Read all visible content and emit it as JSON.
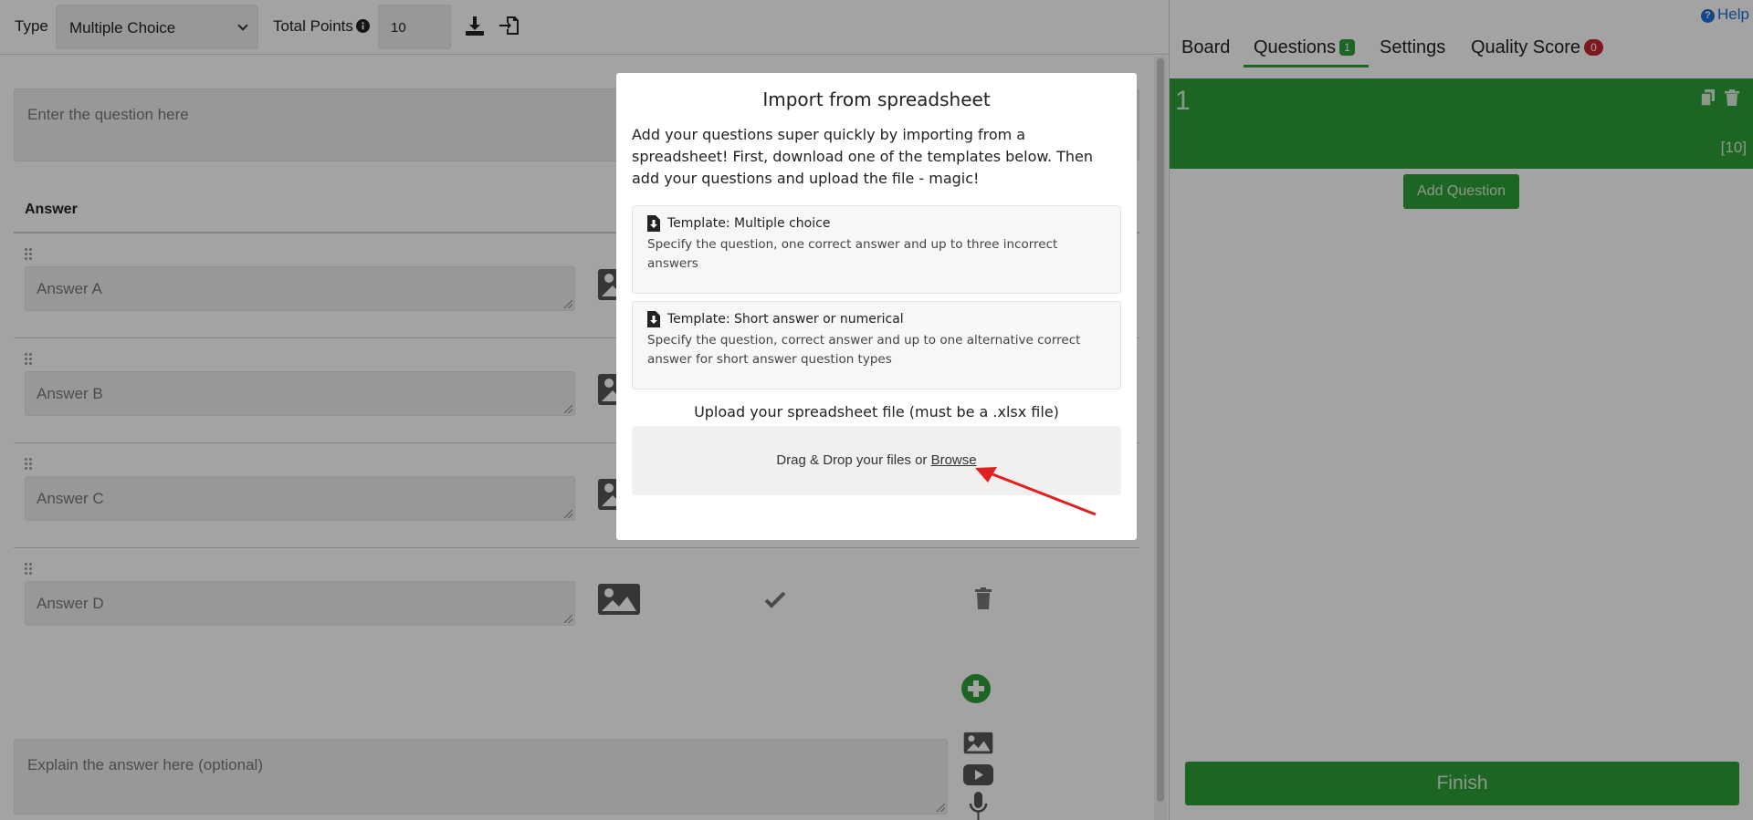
{
  "toolbar": {
    "type_label": "Type",
    "type_value": "Multiple Choice",
    "total_points_label": "Total Points",
    "total_points_value": "10"
  },
  "editor": {
    "question_placeholder": "Enter the question here",
    "answer_header": "Answer",
    "answers": [
      {
        "placeholder": "Answer A"
      },
      {
        "placeholder": "Answer B"
      },
      {
        "placeholder": "Answer C"
      },
      {
        "placeholder": "Answer D"
      }
    ],
    "explanation_placeholder": "Explain the answer here (optional)"
  },
  "sidebar": {
    "help_label": "Help",
    "tabs": [
      {
        "label": "Board",
        "badge": ""
      },
      {
        "label": "Questions",
        "badge": "1"
      },
      {
        "label": "Settings",
        "badge": ""
      },
      {
        "label": "Quality Score",
        "badge": "0"
      }
    ],
    "question_card": {
      "number": "1",
      "points": "[10]"
    },
    "add_question_label": "Add Question",
    "finish_label": "Finish",
    "colors": {
      "green": "#2e9e38",
      "badge_red": "#c0282d",
      "link_blue": "#1d6fd6"
    }
  },
  "modal": {
    "title": "Import from spreadsheet",
    "intro": "Add your questions super quickly by importing from a spreadsheet! First, download one of the templates below. Then add your questions and upload the file - magic!",
    "templates": [
      {
        "title": "Template: Multiple choice",
        "description": "Specify the question, one correct answer and up to three incorrect answers"
      },
      {
        "title": "Template: Short answer or numerical",
        "description": "Specify the question, correct answer and up to one alternative correct answer for short answer question types"
      }
    ],
    "upload_label": "Upload your spreadsheet file (must be a .xlsx file)",
    "dropzone_text": "Drag & Drop your files or ",
    "browse_label": "Browse"
  }
}
